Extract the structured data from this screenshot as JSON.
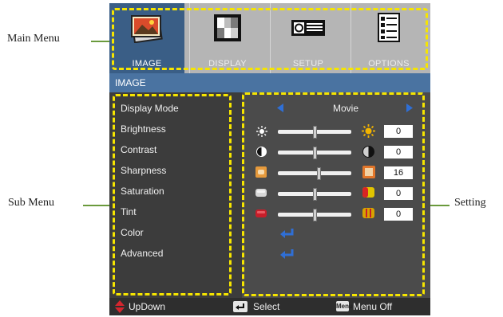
{
  "callouts": {
    "main_menu": "Main Menu",
    "sub_menu": "Sub Menu",
    "setting": "Setting"
  },
  "tabs": [
    {
      "label": "IMAGE",
      "icon": "image-icon",
      "active": true
    },
    {
      "label": "DISPLAY",
      "icon": "display-icon",
      "active": false
    },
    {
      "label": "SETUP",
      "icon": "setup-icon",
      "active": false
    },
    {
      "label": "OPTIONS",
      "icon": "options-icon",
      "active": false
    }
  ],
  "menu_title": "IMAGE",
  "submenu": [
    "Display Mode",
    "Brightness",
    "Contrast",
    "Sharpness",
    "Saturation",
    "Tint",
    "Color",
    "Advanced"
  ],
  "display_mode": "Movie",
  "settings": [
    {
      "name": "brightness",
      "value": "0",
      "level": 0.5,
      "left_icon": "sun-small-icon",
      "right_icon": "sun-large-icon"
    },
    {
      "name": "contrast",
      "value": "0",
      "level": 0.5,
      "left_icon": "contrast-low-icon",
      "right_icon": "contrast-high-icon"
    },
    {
      "name": "sharpness",
      "value": "16",
      "level": 0.55,
      "left_icon": "sharpness-low-icon",
      "right_icon": "sharpness-high-icon"
    },
    {
      "name": "saturation",
      "value": "0",
      "level": 0.5,
      "left_icon": "saturation-low-icon",
      "right_icon": "saturation-high-icon"
    },
    {
      "name": "tint",
      "value": "0",
      "level": 0.5,
      "left_icon": "tint-red-icon",
      "right_icon": "tint-green-icon"
    }
  ],
  "footer": {
    "updown": "UpDown",
    "select": "Select",
    "menu_off": "Menu Off",
    "menu_key": "Menu"
  },
  "colors": {
    "dash": "#f6e500",
    "leader": "#6a9a3c",
    "active_tab": "#3a5e86",
    "title_bar": "#4a73a1",
    "arrow": "#2f6fd6"
  }
}
